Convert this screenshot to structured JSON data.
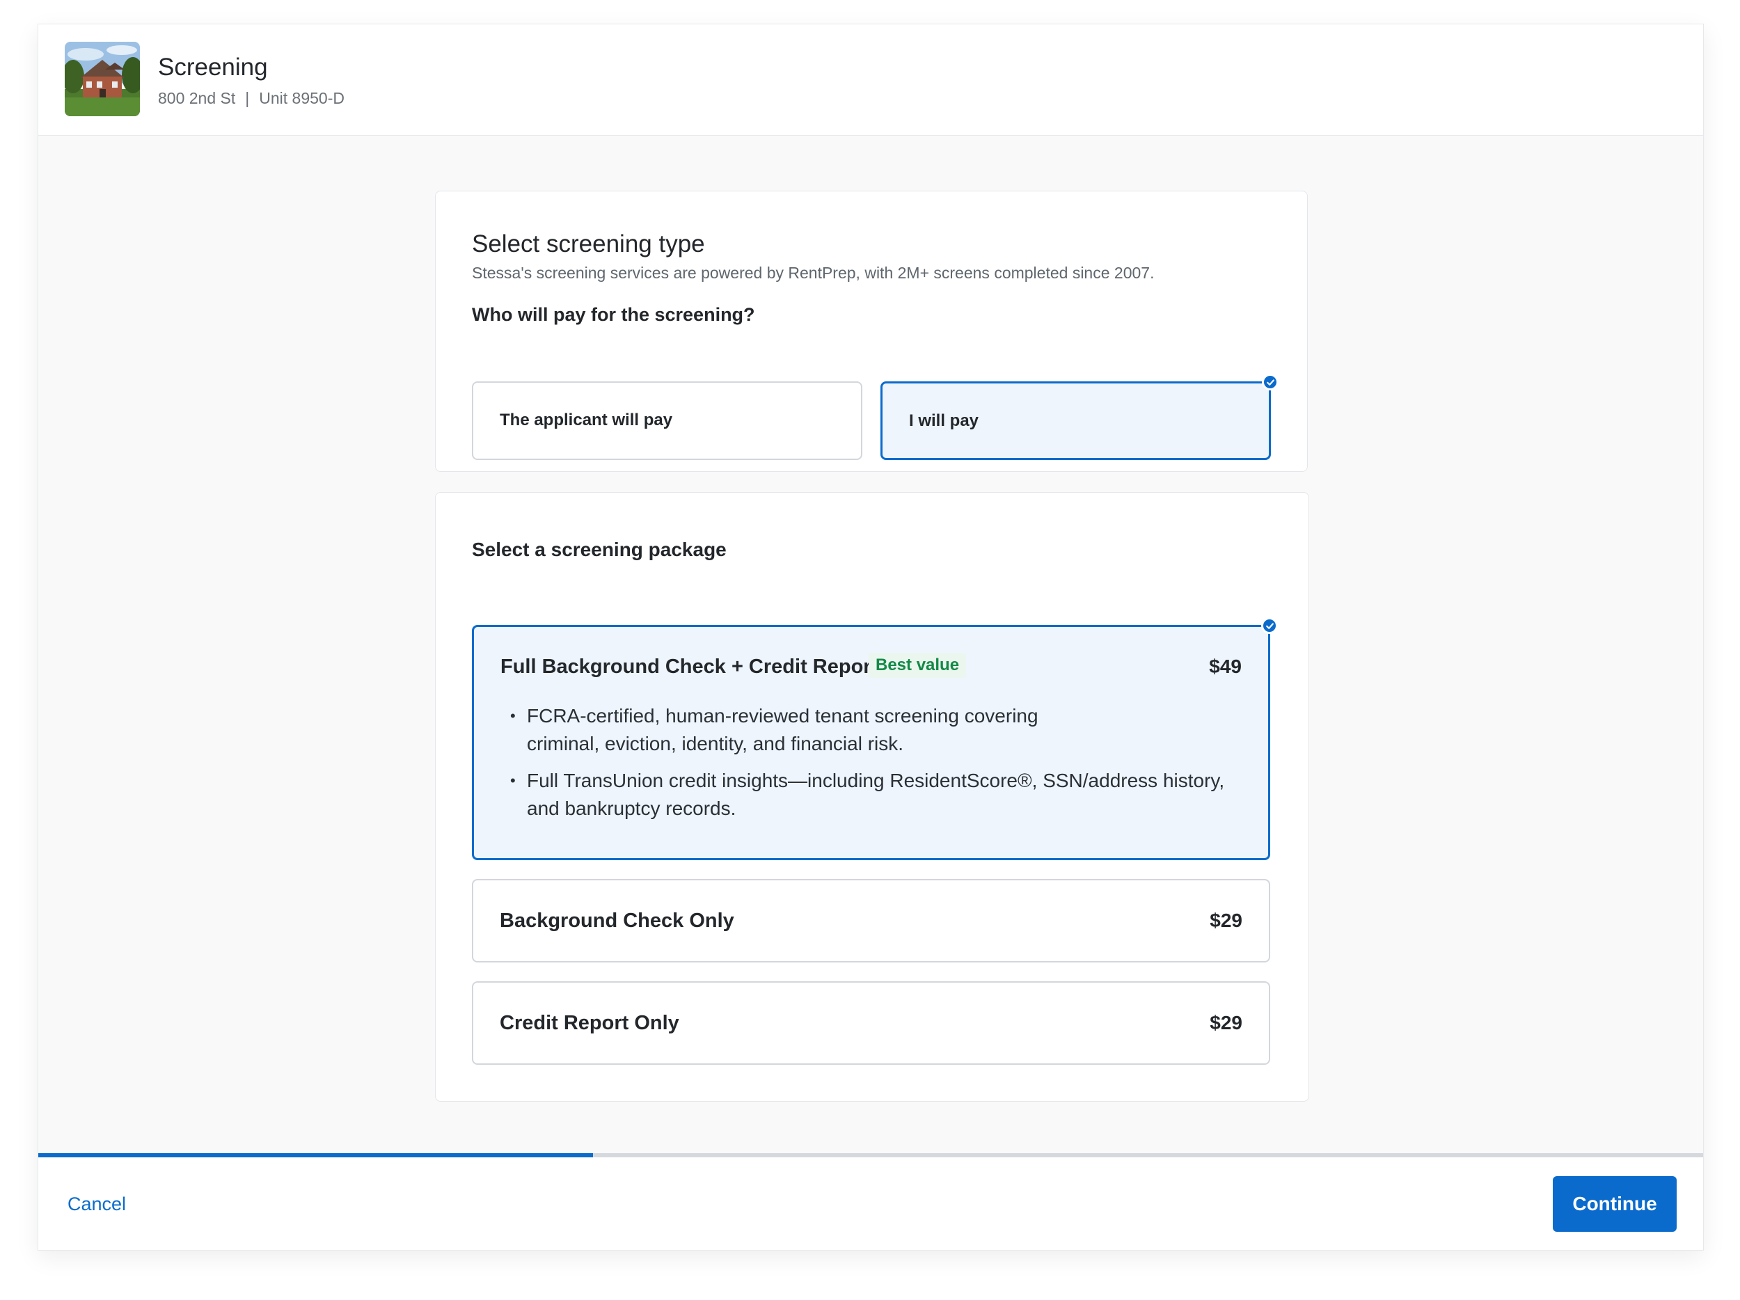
{
  "header": {
    "title": "Screening",
    "address": "800 2nd St",
    "separator": "|",
    "unit": "Unit 8950-D"
  },
  "screening_type": {
    "title": "Select screening type",
    "description": "Stessa's screening services are powered by RentPrep, with 2M+ screens completed since 2007.",
    "question": "Who will pay for the screening?",
    "options": [
      {
        "label": "The applicant will pay",
        "selected": false
      },
      {
        "label": "I will pay",
        "selected": true
      }
    ]
  },
  "packages": {
    "heading": "Select a screening package",
    "items": [
      {
        "name": "Full Background Check + Credit Report",
        "badge": "Best value",
        "price": "$49",
        "selected": true,
        "bullets": [
          "FCRA-certified, human-reviewed tenant screening covering criminal, eviction, identity, and financial risk.",
          "Full TransUnion credit insights—including ResidentScore®, SSN/address history, and bankruptcy records."
        ]
      },
      {
        "name": "Background Check Only",
        "price": "$29",
        "selected": false
      },
      {
        "name": "Credit Report Only",
        "price": "$29",
        "selected": false
      }
    ]
  },
  "progress": {
    "fraction": 0.333
  },
  "footer": {
    "cancel_label": "Cancel",
    "continue_label": "Continue"
  },
  "colors": {
    "accent": "#0a6bcc",
    "selected_bg": "#eef5fd",
    "best_value_text": "#138a47",
    "best_value_bg": "#ebf6ef"
  },
  "icons": {
    "thumbnail": "house-photo",
    "selected_marker": "check-circle-icon"
  }
}
